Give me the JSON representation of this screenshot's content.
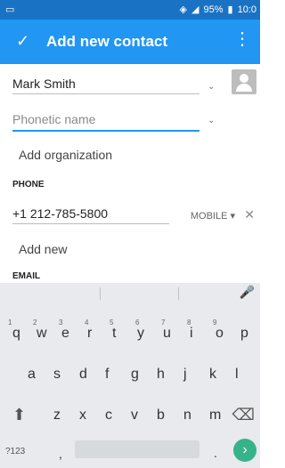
{
  "status": {
    "time": "10:0",
    "battery": "95%"
  },
  "appbar": {
    "title": "Add new contact"
  },
  "form": {
    "name_value": "Mark Smith",
    "phonetic_placeholder": "Phonetic name",
    "organization_label": "Add organization",
    "phone_section": "PHONE",
    "phone_value": "+1 212-785-5800",
    "phone_type": "MOBILE",
    "add_new_label": "Add new",
    "email_section": "EMAIL"
  },
  "keyboard": {
    "row1": [
      "q",
      "w",
      "e",
      "r",
      "t",
      "y",
      "u",
      "i",
      "o",
      "p"
    ],
    "row1_hints": [
      "1",
      "2",
      "3",
      "4",
      "5",
      "6",
      "7",
      "8",
      "9"
    ],
    "row2": [
      "a",
      "s",
      "d",
      "f",
      "g",
      "h",
      "j",
      "k",
      "l"
    ],
    "row3": [
      "z",
      "x",
      "c",
      "v",
      "b",
      "n",
      "m"
    ],
    "symbols_label": "?123",
    "comma": ",",
    "period": "."
  },
  "icons": {
    "check": "check-icon",
    "overflow": "overflow-menu-icon",
    "avatar": "contact-photo-icon",
    "mic": "microphone-icon",
    "shift": "shift-icon",
    "backspace": "backspace-icon",
    "go": "go-arrow-icon"
  },
  "colors": {
    "appbar": "#2196f3",
    "statusbar": "#1a72c4",
    "accent": "#2196f3",
    "go": "#37b38a"
  }
}
